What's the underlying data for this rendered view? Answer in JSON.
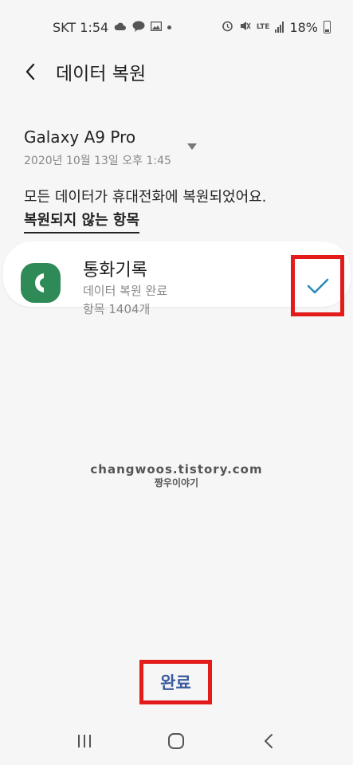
{
  "status_bar": {
    "carrier_time": "SKT 1:54",
    "lte": "LTE",
    "battery": "18%"
  },
  "app_bar": {
    "title": "데이터 복원"
  },
  "device": {
    "name": "Galaxy A9 Pro",
    "date": "2020년 10월 13일 오후 1:45"
  },
  "message": "모든 데이터가 휴대전화에 복원되었어요.",
  "not_restored_link": "복원되지 않는 항목",
  "item": {
    "title": "통화기록",
    "status": "데이터 복원 완료",
    "count": "항목 1404개",
    "icon": "phone-icon",
    "icon_color": "#2e8b57",
    "checked": true
  },
  "watermark": {
    "url": "changwoos.tistory.com",
    "name": "짱우이야기"
  },
  "done_button": "완료",
  "colors": {
    "accent": "#3a5b9e",
    "highlight": "#e31b1b",
    "check": "#2a8cb8"
  }
}
